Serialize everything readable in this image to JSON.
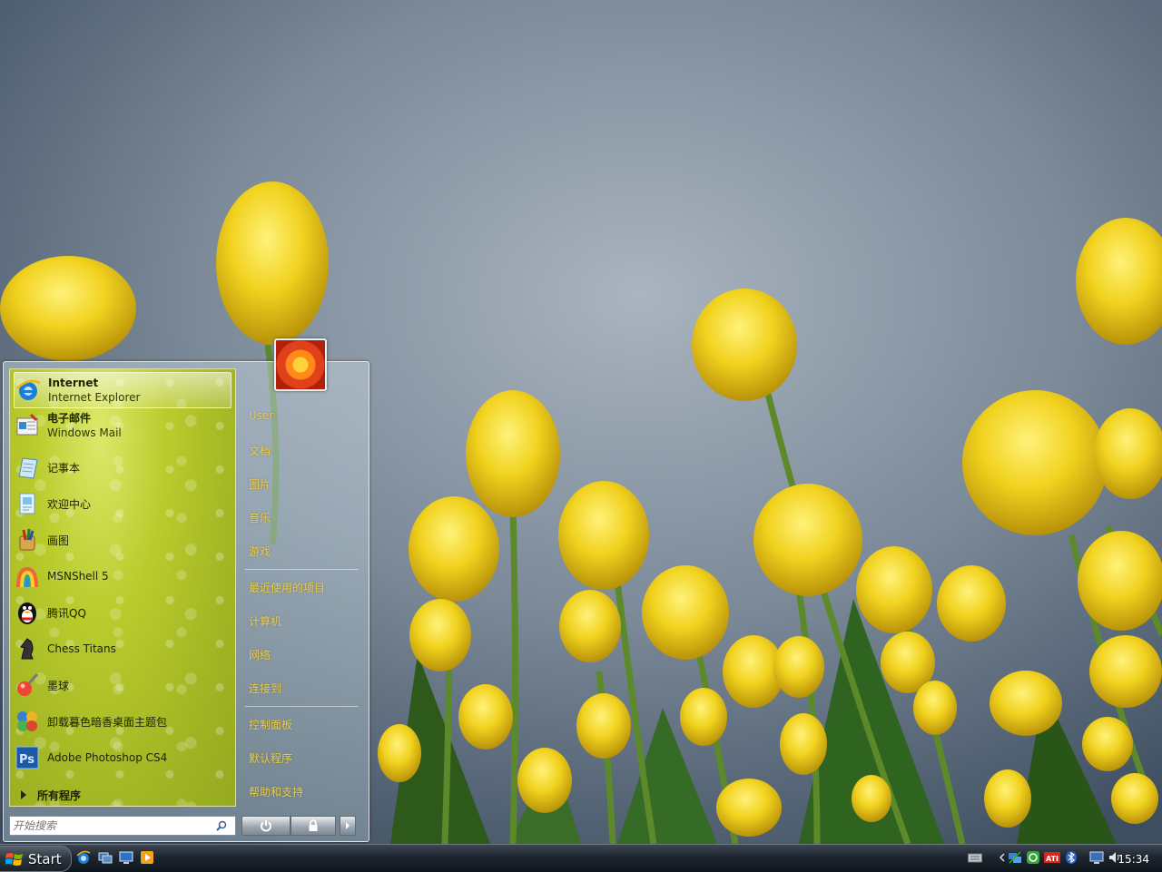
{
  "start_menu": {
    "pinned": [
      {
        "title": "Internet",
        "subtitle": "Internet Explorer"
      },
      {
        "title": "电子邮件",
        "subtitle": "Windows Mail"
      }
    ],
    "recent": [
      {
        "label": "记事本"
      },
      {
        "label": "欢迎中心"
      },
      {
        "label": "画图"
      },
      {
        "label": "MSNShell 5"
      },
      {
        "label": "腾讯QQ"
      },
      {
        "label": "Chess Titans"
      },
      {
        "label": "墨球"
      },
      {
        "label": "卸载暮色暗香桌面主题包"
      },
      {
        "label": "Adobe Photoshop CS4"
      }
    ],
    "all_programs": "所有程序",
    "search_placeholder": "开始搜索",
    "right_links": {
      "user": "User",
      "documents": "文档",
      "pictures": "图片",
      "music": "音乐",
      "games": "游戏",
      "recent_items": "最近使用的项目",
      "computer": "计算机",
      "network": "网络",
      "connect_to": "连接到",
      "control_panel": "控制面板",
      "default_programs": "默认程序",
      "help_support": "帮助和支持"
    }
  },
  "taskbar": {
    "start_label": "Start",
    "clock": "15:34"
  },
  "icons": {
    "quick_launch": [
      "internet-explorer-icon",
      "switch-windows-icon",
      "show-desktop-icon",
      "media-player-icon"
    ],
    "tray": [
      "keyboard-icon",
      "show-hidden-icons-chevron",
      "network-icon",
      "security-icon",
      "ati-icon",
      "bluetooth-icon",
      "monitor-icon",
      "volume-icon"
    ]
  },
  "colors": {
    "left_pane": "#b9cb2c",
    "right_link": "#e8cc4a",
    "taskbar": "#1d2630"
  }
}
